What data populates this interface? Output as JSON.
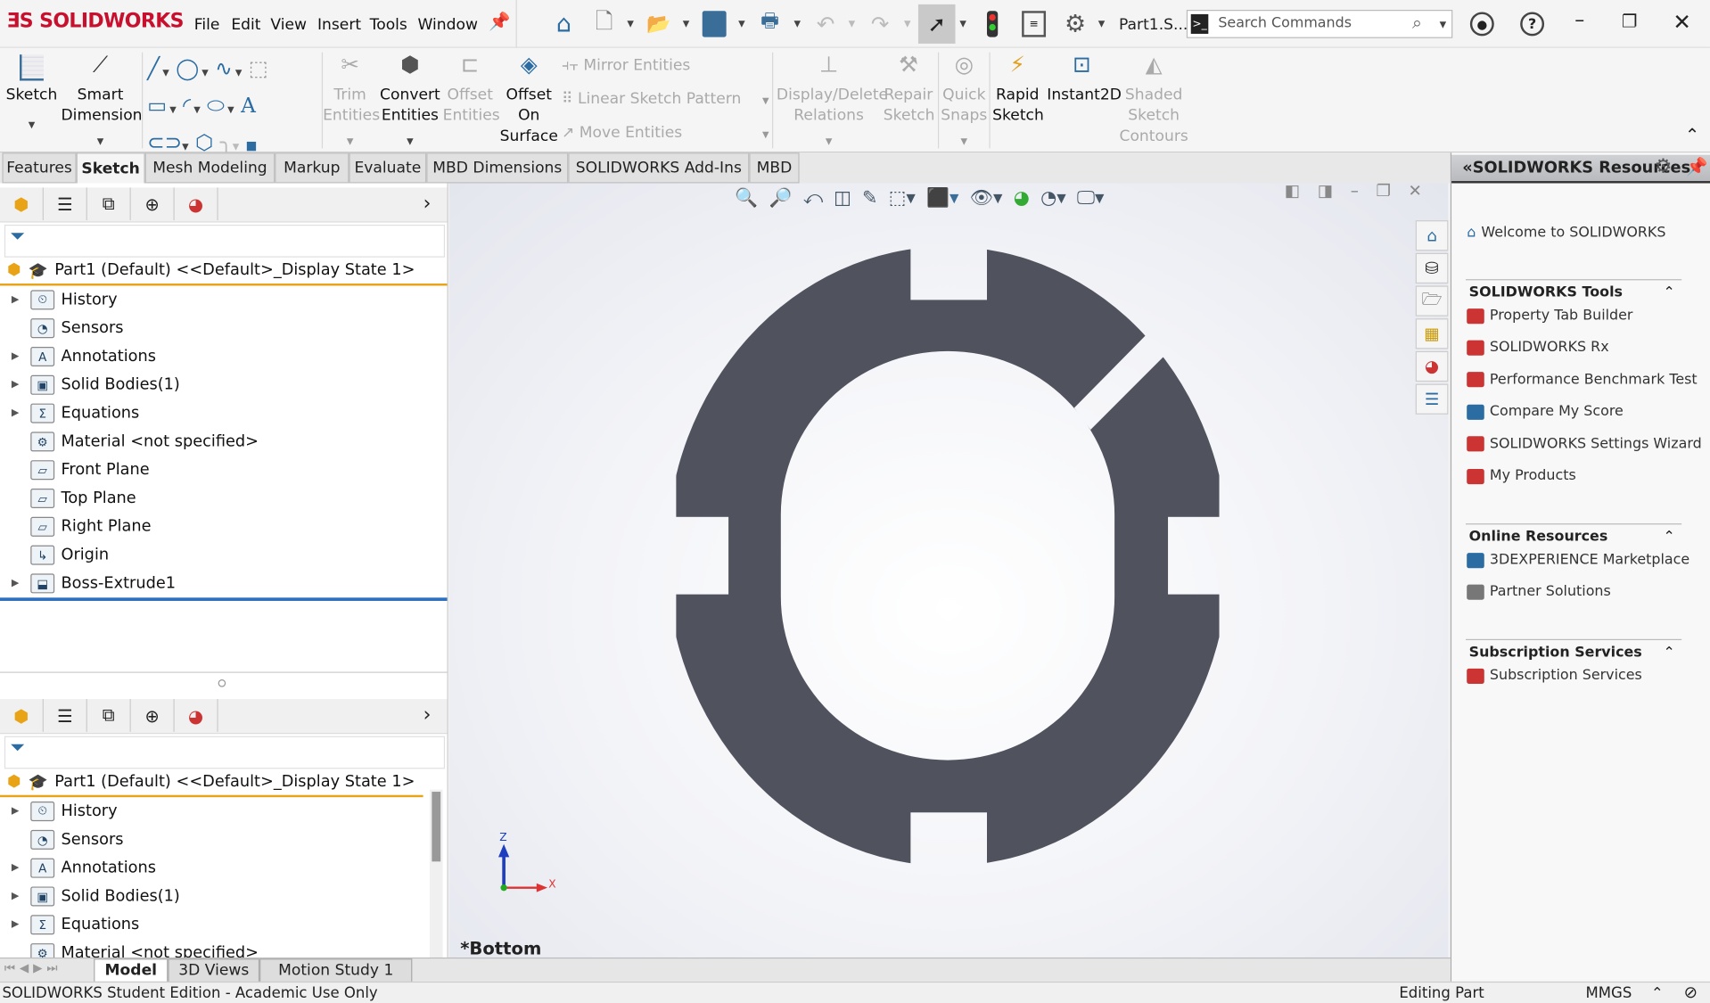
{
  "app": {
    "logo": "SOLIDWORKS",
    "doc_title": "Part1.S...",
    "colors": {
      "brand": "#c8102e",
      "part_fill": "#50525e",
      "tree_highlight": "#e8a317",
      "tree_end": "#2f6fbf"
    }
  },
  "menu": [
    "File",
    "Edit",
    "View",
    "Insert",
    "Tools",
    "Window"
  ],
  "toolbar": {
    "icons": [
      "home-icon",
      "new-document-icon",
      "open-icon",
      "save-icon",
      "print-icon",
      "undo-icon",
      "redo-icon",
      "select-icon",
      "rebuild-icon",
      "file-properties-icon",
      "options-icon"
    ]
  },
  "search": {
    "placeholder": "Search Commands"
  },
  "ribbon": {
    "sketch": "Sketch",
    "smart_dimension": [
      "Smart",
      "Dimension"
    ],
    "trim": [
      "Trim",
      "Entities"
    ],
    "convert": [
      "Convert",
      "Entities"
    ],
    "offset": [
      "Offset",
      "Entities"
    ],
    "offset_surface": [
      "Offset",
      "On",
      "Surface"
    ],
    "mirror": "Mirror Entities",
    "linear_pattern": "Linear Sketch Pattern",
    "move": "Move Entities",
    "display_delete": [
      "Display/Delete",
      "Relations"
    ],
    "repair": [
      "Repair",
      "Sketch"
    ],
    "quick_snaps": [
      "Quick",
      "Snaps"
    ],
    "rapid_sketch": [
      "Rapid",
      "Sketch"
    ],
    "instant2d": "Instant2D",
    "shaded": [
      "Shaded",
      "Sketch",
      "Contours"
    ]
  },
  "tabs": [
    {
      "label": "Features"
    },
    {
      "label": "Sketch",
      "active": true
    },
    {
      "label": "Mesh Modeling"
    },
    {
      "label": "Markup"
    },
    {
      "label": "Evaluate"
    },
    {
      "label": "MBD Dimensions"
    },
    {
      "label": "SOLIDWORKS Add-Ins"
    },
    {
      "label": "MBD"
    }
  ],
  "tree": {
    "root": "Part1 (Default) <<Default>_Display State 1>",
    "items": [
      {
        "label": "History",
        "expandable": true,
        "icon": "history-icon"
      },
      {
        "label": "Sensors",
        "expandable": false,
        "icon": "sensors-icon"
      },
      {
        "label": "Annotations",
        "expandable": true,
        "icon": "annotations-icon"
      },
      {
        "label": "Solid Bodies(1)",
        "expandable": true,
        "icon": "solid-bodies-icon"
      },
      {
        "label": "Equations",
        "expandable": true,
        "icon": "equations-icon"
      },
      {
        "label": "Material <not specified>",
        "expandable": false,
        "icon": "material-icon"
      },
      {
        "label": "Front Plane",
        "expandable": false,
        "icon": "plane-icon"
      },
      {
        "label": "Top Plane",
        "expandable": false,
        "icon": "plane-icon"
      },
      {
        "label": "Right Plane",
        "expandable": false,
        "icon": "plane-icon"
      },
      {
        "label": "Origin",
        "expandable": false,
        "icon": "origin-icon"
      },
      {
        "label": "Boss-Extrude1",
        "expandable": true,
        "icon": "extrude-icon"
      }
    ]
  },
  "tree2": {
    "root": "Part1 (Default) <<Default>_Display State 1>",
    "items": [
      {
        "label": "History"
      },
      {
        "label": "Sensors"
      },
      {
        "label": "Annotations"
      },
      {
        "label": "Solid Bodies(1)"
      },
      {
        "label": "Equations"
      },
      {
        "label": "Material <not specified>"
      }
    ]
  },
  "viewport": {
    "view_label": "*Bottom",
    "axis_z": "Z",
    "axis_x": "X"
  },
  "resources": {
    "title": "SOLIDWORKS Resources",
    "welcome": "Welcome to SOLIDWORKS",
    "sections": [
      {
        "title": "SOLIDWORKS Tools",
        "items": [
          "Property Tab Builder",
          "SOLIDWORKS Rx",
          "Performance Benchmark Test",
          "Compare My Score",
          "SOLIDWORKS Settings Wizard",
          "My Products"
        ]
      },
      {
        "title": "Online Resources",
        "items": [
          "3DEXPERIENCE Marketplace",
          "Partner Solutions"
        ]
      },
      {
        "title": "Subscription Services",
        "items": [
          "Subscription Services"
        ]
      }
    ]
  },
  "bottom_tabs": [
    {
      "label": "Model",
      "active": true
    },
    {
      "label": "3D Views"
    },
    {
      "label": "Motion Study 1"
    }
  ],
  "status": {
    "left": "SOLIDWORKS Student Edition - Academic Use Only",
    "mode": "Editing Part",
    "units": "MMGS"
  }
}
